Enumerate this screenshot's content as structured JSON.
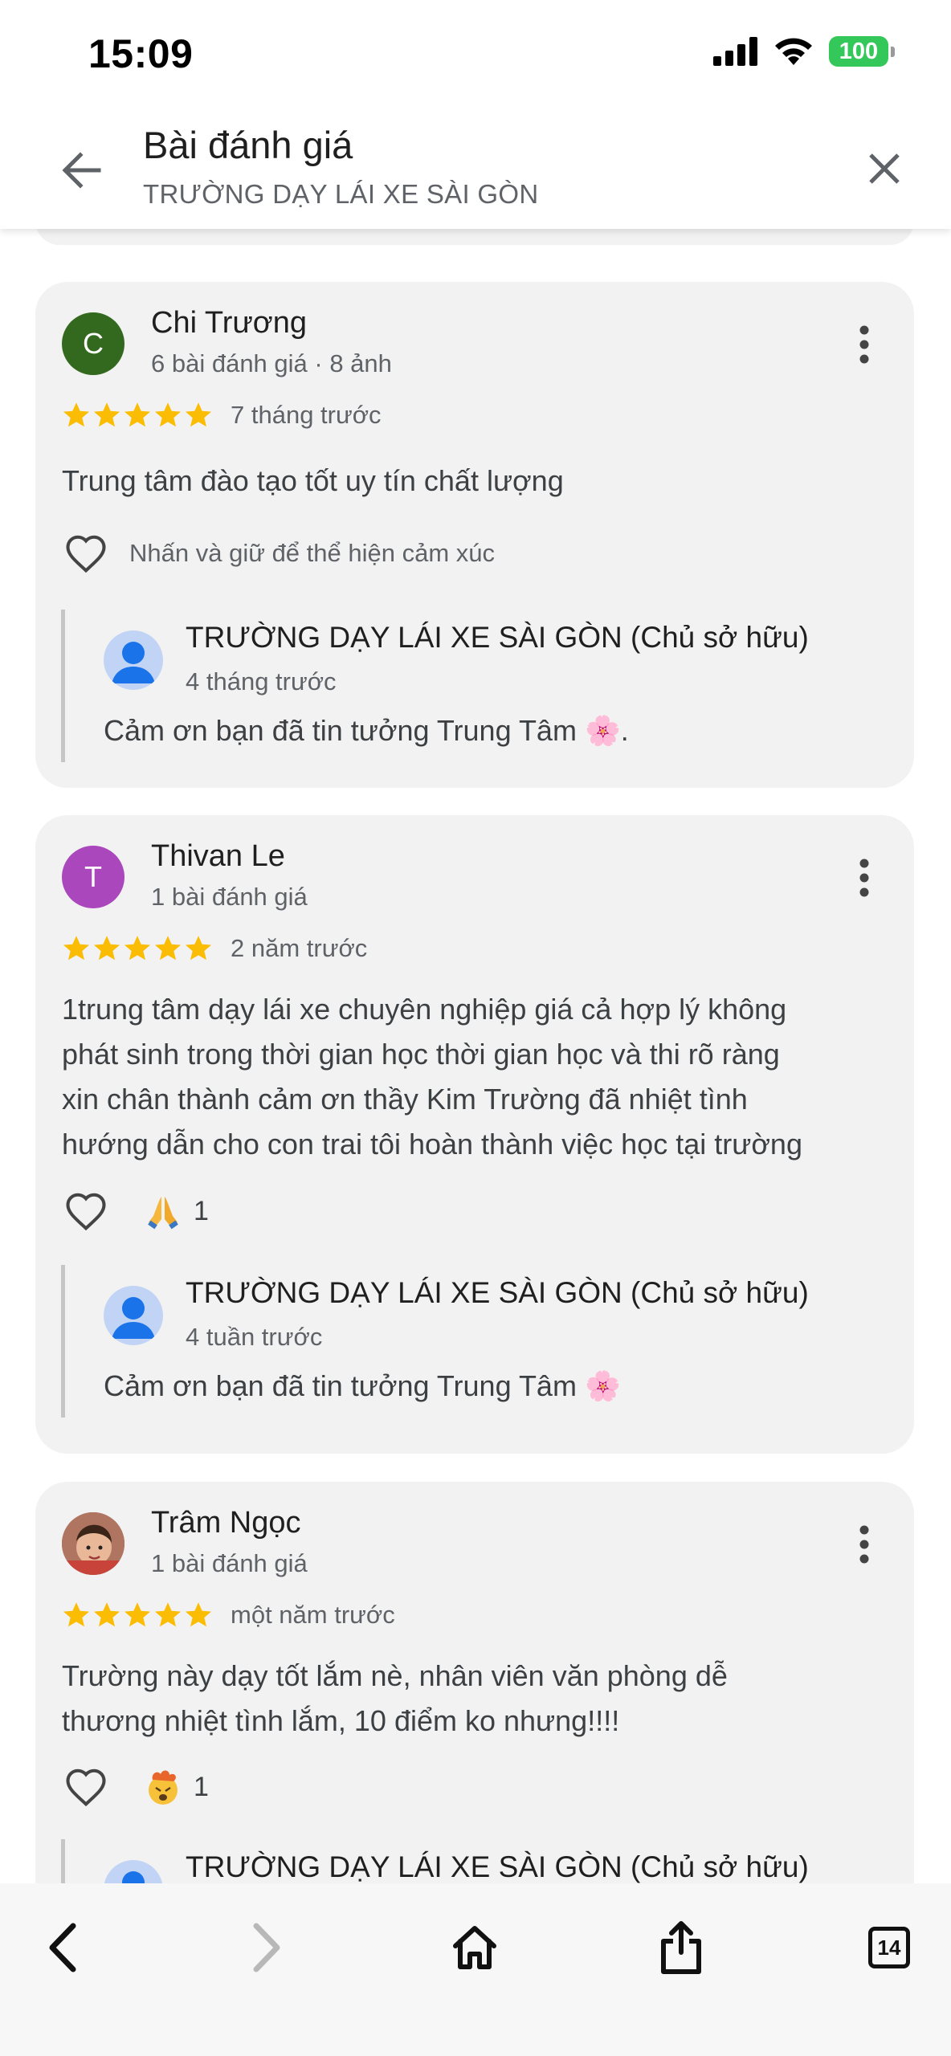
{
  "status_bar": {
    "time": "15:09",
    "battery": "100",
    "icons": [
      "cellular-signal-icon",
      "wifi-icon",
      "battery-icon"
    ],
    "battery_color": "#34c759"
  },
  "header": {
    "title": "Bài đánh giá",
    "subtitle": "TRƯỜNG DẠY LÁI XE SÀI GÒN",
    "back_icon": "arrow-left-icon",
    "close_icon": "close-icon"
  },
  "reviews": [
    {
      "avatar_letter": "C",
      "avatar_color": "#33691e",
      "name": "Chi Trương",
      "meta": "6 bài đánh giá · 8 ảnh",
      "rating": 5,
      "date": "7 tháng trước",
      "text": "Trung tâm đào tạo tốt uy tín chất lượng",
      "reaction_hint": "Nhấn và giữ để thể hiện cảm xúc",
      "reply": {
        "name": "TRƯỜNG DẠY LÁI XE SÀI GÒN (Chủ sở hữu)",
        "date": "4 tháng trước",
        "text": "Cảm ơn bạn đã tin tưởng Trung Tâm 🌸."
      }
    },
    {
      "avatar_letter": "T",
      "avatar_color": "#aa47bc",
      "name": "Thivan Le",
      "meta": "1 bài đánh giá",
      "rating": 5,
      "date": "2 năm trước",
      "text_lines": [
        "1trung tâm dạy lái xe chuyên nghiệp giá cả hợp lý không",
        "phát sinh trong thời gian học thời gian học và thi rõ ràng",
        "xin chân thành cảm ơn thầy Kim Trường đã nhiệt tình",
        "hướng dẫn cho con trai tôi hoàn thành việc học tại trường"
      ],
      "reaction_emoji": "folded-hands-emoji",
      "reaction_count": "1",
      "reply": {
        "name": "TRƯỜNG DẠY LÁI XE SÀI GÒN (Chủ sở hữu)",
        "date": "4 tuần trước",
        "text": "Cảm ơn bạn đã tin tưởng Trung Tâm 🌸"
      }
    },
    {
      "avatar_photo": "child-photo-avatar",
      "name": "Trâm Ngọc",
      "meta": "1 bài đánh giá",
      "rating": 5,
      "date": "một năm trước",
      "text_lines": [
        "Trường này dạy tốt lắm nè, nhân viên văn phòng dễ",
        "thương nhiệt tình lắm, 10 điểm ko nhưng!!!!"
      ],
      "reaction_emoji": "exploding-head-emoji",
      "reaction_count": "1",
      "reply": {
        "name": "TRƯỜNG DẠY LÁI XE SÀI GÒN (Chủ sở hữu)"
      }
    }
  ],
  "star_color": "#fbbc04",
  "browser_toolbar": {
    "tab_count": "14",
    "icons": [
      "back-chevron-icon",
      "forward-chevron-icon",
      "home-icon",
      "share-icon",
      "tabs-icon"
    ]
  }
}
